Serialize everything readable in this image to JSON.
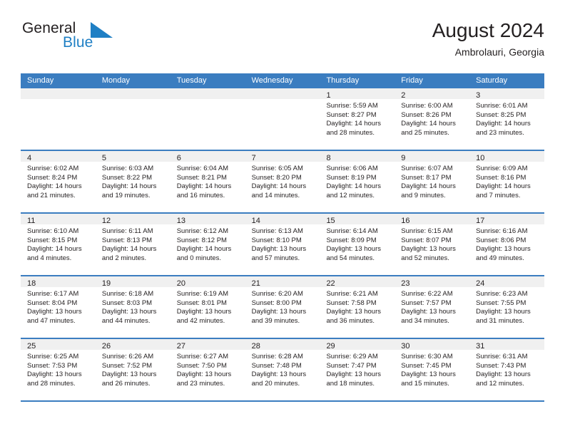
{
  "brand": {
    "word_general": "General",
    "word_blue": "Blue",
    "mark": "triangle-logo-icon",
    "accent_color": "#1f7fc4"
  },
  "header": {
    "title": "August 2024",
    "subtitle": "Ambrolauri, Georgia"
  },
  "theme": {
    "header_blue": "#3b7dc0",
    "daynum_band": "#f0f0f0",
    "text": "#231f20"
  },
  "weekdays": [
    "Sunday",
    "Monday",
    "Tuesday",
    "Wednesday",
    "Thursday",
    "Friday",
    "Saturday"
  ],
  "weeks": [
    [
      {
        "day": "",
        "lines": []
      },
      {
        "day": "",
        "lines": []
      },
      {
        "day": "",
        "lines": []
      },
      {
        "day": "",
        "lines": []
      },
      {
        "day": "1",
        "lines": [
          "Sunrise: 5:59 AM",
          "Sunset: 8:27 PM",
          "Daylight: 14 hours",
          "and 28 minutes."
        ]
      },
      {
        "day": "2",
        "lines": [
          "Sunrise: 6:00 AM",
          "Sunset: 8:26 PM",
          "Daylight: 14 hours",
          "and 25 minutes."
        ]
      },
      {
        "day": "3",
        "lines": [
          "Sunrise: 6:01 AM",
          "Sunset: 8:25 PM",
          "Daylight: 14 hours",
          "and 23 minutes."
        ]
      }
    ],
    [
      {
        "day": "4",
        "lines": [
          "Sunrise: 6:02 AM",
          "Sunset: 8:24 PM",
          "Daylight: 14 hours",
          "and 21 minutes."
        ]
      },
      {
        "day": "5",
        "lines": [
          "Sunrise: 6:03 AM",
          "Sunset: 8:22 PM",
          "Daylight: 14 hours",
          "and 19 minutes."
        ]
      },
      {
        "day": "6",
        "lines": [
          "Sunrise: 6:04 AM",
          "Sunset: 8:21 PM",
          "Daylight: 14 hours",
          "and 16 minutes."
        ]
      },
      {
        "day": "7",
        "lines": [
          "Sunrise: 6:05 AM",
          "Sunset: 8:20 PM",
          "Daylight: 14 hours",
          "and 14 minutes."
        ]
      },
      {
        "day": "8",
        "lines": [
          "Sunrise: 6:06 AM",
          "Sunset: 8:19 PM",
          "Daylight: 14 hours",
          "and 12 minutes."
        ]
      },
      {
        "day": "9",
        "lines": [
          "Sunrise: 6:07 AM",
          "Sunset: 8:17 PM",
          "Daylight: 14 hours",
          "and 9 minutes."
        ]
      },
      {
        "day": "10",
        "lines": [
          "Sunrise: 6:09 AM",
          "Sunset: 8:16 PM",
          "Daylight: 14 hours",
          "and 7 minutes."
        ]
      }
    ],
    [
      {
        "day": "11",
        "lines": [
          "Sunrise: 6:10 AM",
          "Sunset: 8:15 PM",
          "Daylight: 14 hours",
          "and 4 minutes."
        ]
      },
      {
        "day": "12",
        "lines": [
          "Sunrise: 6:11 AM",
          "Sunset: 8:13 PM",
          "Daylight: 14 hours",
          "and 2 minutes."
        ]
      },
      {
        "day": "13",
        "lines": [
          "Sunrise: 6:12 AM",
          "Sunset: 8:12 PM",
          "Daylight: 14 hours",
          "and 0 minutes."
        ]
      },
      {
        "day": "14",
        "lines": [
          "Sunrise: 6:13 AM",
          "Sunset: 8:10 PM",
          "Daylight: 13 hours",
          "and 57 minutes."
        ]
      },
      {
        "day": "15",
        "lines": [
          "Sunrise: 6:14 AM",
          "Sunset: 8:09 PM",
          "Daylight: 13 hours",
          "and 54 minutes."
        ]
      },
      {
        "day": "16",
        "lines": [
          "Sunrise: 6:15 AM",
          "Sunset: 8:07 PM",
          "Daylight: 13 hours",
          "and 52 minutes."
        ]
      },
      {
        "day": "17",
        "lines": [
          "Sunrise: 6:16 AM",
          "Sunset: 8:06 PM",
          "Daylight: 13 hours",
          "and 49 minutes."
        ]
      }
    ],
    [
      {
        "day": "18",
        "lines": [
          "Sunrise: 6:17 AM",
          "Sunset: 8:04 PM",
          "Daylight: 13 hours",
          "and 47 minutes."
        ]
      },
      {
        "day": "19",
        "lines": [
          "Sunrise: 6:18 AM",
          "Sunset: 8:03 PM",
          "Daylight: 13 hours",
          "and 44 minutes."
        ]
      },
      {
        "day": "20",
        "lines": [
          "Sunrise: 6:19 AM",
          "Sunset: 8:01 PM",
          "Daylight: 13 hours",
          "and 42 minutes."
        ]
      },
      {
        "day": "21",
        "lines": [
          "Sunrise: 6:20 AM",
          "Sunset: 8:00 PM",
          "Daylight: 13 hours",
          "and 39 minutes."
        ]
      },
      {
        "day": "22",
        "lines": [
          "Sunrise: 6:21 AM",
          "Sunset: 7:58 PM",
          "Daylight: 13 hours",
          "and 36 minutes."
        ]
      },
      {
        "day": "23",
        "lines": [
          "Sunrise: 6:22 AM",
          "Sunset: 7:57 PM",
          "Daylight: 13 hours",
          "and 34 minutes."
        ]
      },
      {
        "day": "24",
        "lines": [
          "Sunrise: 6:23 AM",
          "Sunset: 7:55 PM",
          "Daylight: 13 hours",
          "and 31 minutes."
        ]
      }
    ],
    [
      {
        "day": "25",
        "lines": [
          "Sunrise: 6:25 AM",
          "Sunset: 7:53 PM",
          "Daylight: 13 hours",
          "and 28 minutes."
        ]
      },
      {
        "day": "26",
        "lines": [
          "Sunrise: 6:26 AM",
          "Sunset: 7:52 PM",
          "Daylight: 13 hours",
          "and 26 minutes."
        ]
      },
      {
        "day": "27",
        "lines": [
          "Sunrise: 6:27 AM",
          "Sunset: 7:50 PM",
          "Daylight: 13 hours",
          "and 23 minutes."
        ]
      },
      {
        "day": "28",
        "lines": [
          "Sunrise: 6:28 AM",
          "Sunset: 7:48 PM",
          "Daylight: 13 hours",
          "and 20 minutes."
        ]
      },
      {
        "day": "29",
        "lines": [
          "Sunrise: 6:29 AM",
          "Sunset: 7:47 PM",
          "Daylight: 13 hours",
          "and 18 minutes."
        ]
      },
      {
        "day": "30",
        "lines": [
          "Sunrise: 6:30 AM",
          "Sunset: 7:45 PM",
          "Daylight: 13 hours",
          "and 15 minutes."
        ]
      },
      {
        "day": "31",
        "lines": [
          "Sunrise: 6:31 AM",
          "Sunset: 7:43 PM",
          "Daylight: 13 hours",
          "and 12 minutes."
        ]
      }
    ]
  ]
}
